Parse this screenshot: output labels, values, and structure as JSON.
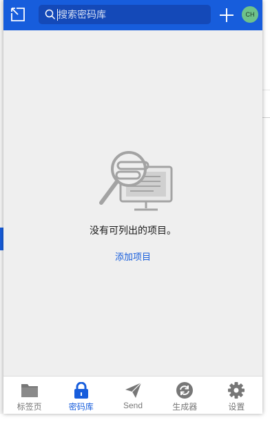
{
  "header": {
    "search": {
      "placeholder": "搜索密码库",
      "value": ""
    },
    "avatar": {
      "initials": "CH"
    },
    "icons": {
      "popout": "popout-icon",
      "search": "search-icon",
      "add": "plus-icon"
    }
  },
  "main": {
    "empty_message": "没有可列出的项目。",
    "add_item_label": "添加项目"
  },
  "tabs": [
    {
      "label": "标签页",
      "icon": "folder-icon",
      "active": false
    },
    {
      "label": "密码库",
      "icon": "lock-icon",
      "active": true
    },
    {
      "label": "Send",
      "icon": "send-icon",
      "active": false
    },
    {
      "label": "生成器",
      "icon": "generator-icon",
      "active": false
    },
    {
      "label": "设置",
      "icon": "gear-icon",
      "active": false
    }
  ],
  "colors": {
    "brand": "#175ddc",
    "background": "#efefef",
    "inactive": "#777777",
    "avatar": "#6ec28a"
  }
}
